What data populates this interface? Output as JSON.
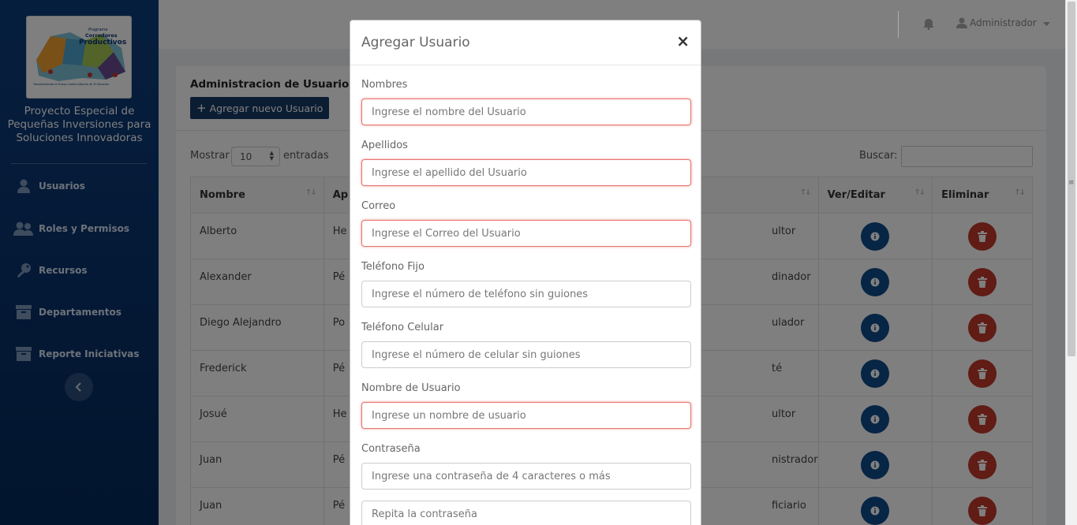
{
  "sidebar": {
    "logo": {
      "line1": "Programa",
      "line2": "Corredores",
      "line3": "Productivos",
      "tagline": "Transformando la Franja Costero-Marina de El Salvador"
    },
    "org_name": "Proyecto Especial de Pequeñas Inversiones para Soluciones Innovadoras",
    "items": [
      {
        "label": "Usuarios",
        "icon": "user-icon"
      },
      {
        "label": "Roles y Permisos",
        "icon": "users-icon"
      },
      {
        "label": "Recursos",
        "icon": "key-icon"
      },
      {
        "label": "Departamentos",
        "icon": "archive-icon"
      },
      {
        "label": "Reporte Iniciativas",
        "icon": "archive-icon"
      }
    ]
  },
  "header": {
    "user_name": "Administrador"
  },
  "page": {
    "title": "Administracion de Usuarios",
    "add_button": "Agregar nuevo Usuario",
    "show_label": "Mostrar",
    "page_size": "10",
    "entries_label": "entradas",
    "search_label": "Buscar:"
  },
  "table": {
    "columns": [
      "Nombre",
      "Ap",
      "",
      "Ver/Editar",
      "Eliminar"
    ],
    "rows": [
      {
        "nombre": "Alberto",
        "apellido": "He",
        "rol": "ultor"
      },
      {
        "nombre": "Alexander",
        "apellido": "Pé",
        "rol": "dinador"
      },
      {
        "nombre": "Diego Alejandro",
        "apellido": "Po",
        "rol": "ulador"
      },
      {
        "nombre": "Frederick",
        "apellido": "Pé",
        "rol": "té evaluador"
      },
      {
        "nombre": "Josué",
        "apellido": "He",
        "rol": "ultor"
      },
      {
        "nombre": "Juan",
        "apellido": "Pé",
        "rol": "nistrador"
      },
      {
        "nombre": "Juan",
        "apellido": "Pé",
        "rol": "ficiario"
      }
    ]
  },
  "modal": {
    "title": "Agregar Usuario",
    "close": "×",
    "fields": {
      "nombres": {
        "label": "Nombres",
        "placeholder": "Ingrese el nombre del Usuario"
      },
      "apellidos": {
        "label": "Apellidos",
        "placeholder": "Ingrese el apellido del Usuario"
      },
      "correo": {
        "label": "Correo",
        "placeholder": "Ingrese el Correo del Usuario"
      },
      "tel_fijo": {
        "label": "Teléfono Fijo",
        "placeholder": "Ingrese el número de teléfono sin guiones"
      },
      "tel_cel": {
        "label": "Teléfono Celular",
        "placeholder": "Ingrese el número de celular sin guiones"
      },
      "usuario": {
        "label": "Nombre de Usuario",
        "placeholder": "Ingrese un nombre de usuario"
      },
      "password": {
        "label": "Contraseña",
        "placeholder": "Ingrese una contraseña de 4 caracteres o más"
      },
      "password2": {
        "placeholder": "Repita la contraseña"
      }
    }
  },
  "colors": {
    "sidebar": "#0a3570",
    "primary_button": "#163a66",
    "info_button": "#0e4a8a",
    "delete_button": "#c0392b",
    "error_border": "#e8736d"
  }
}
